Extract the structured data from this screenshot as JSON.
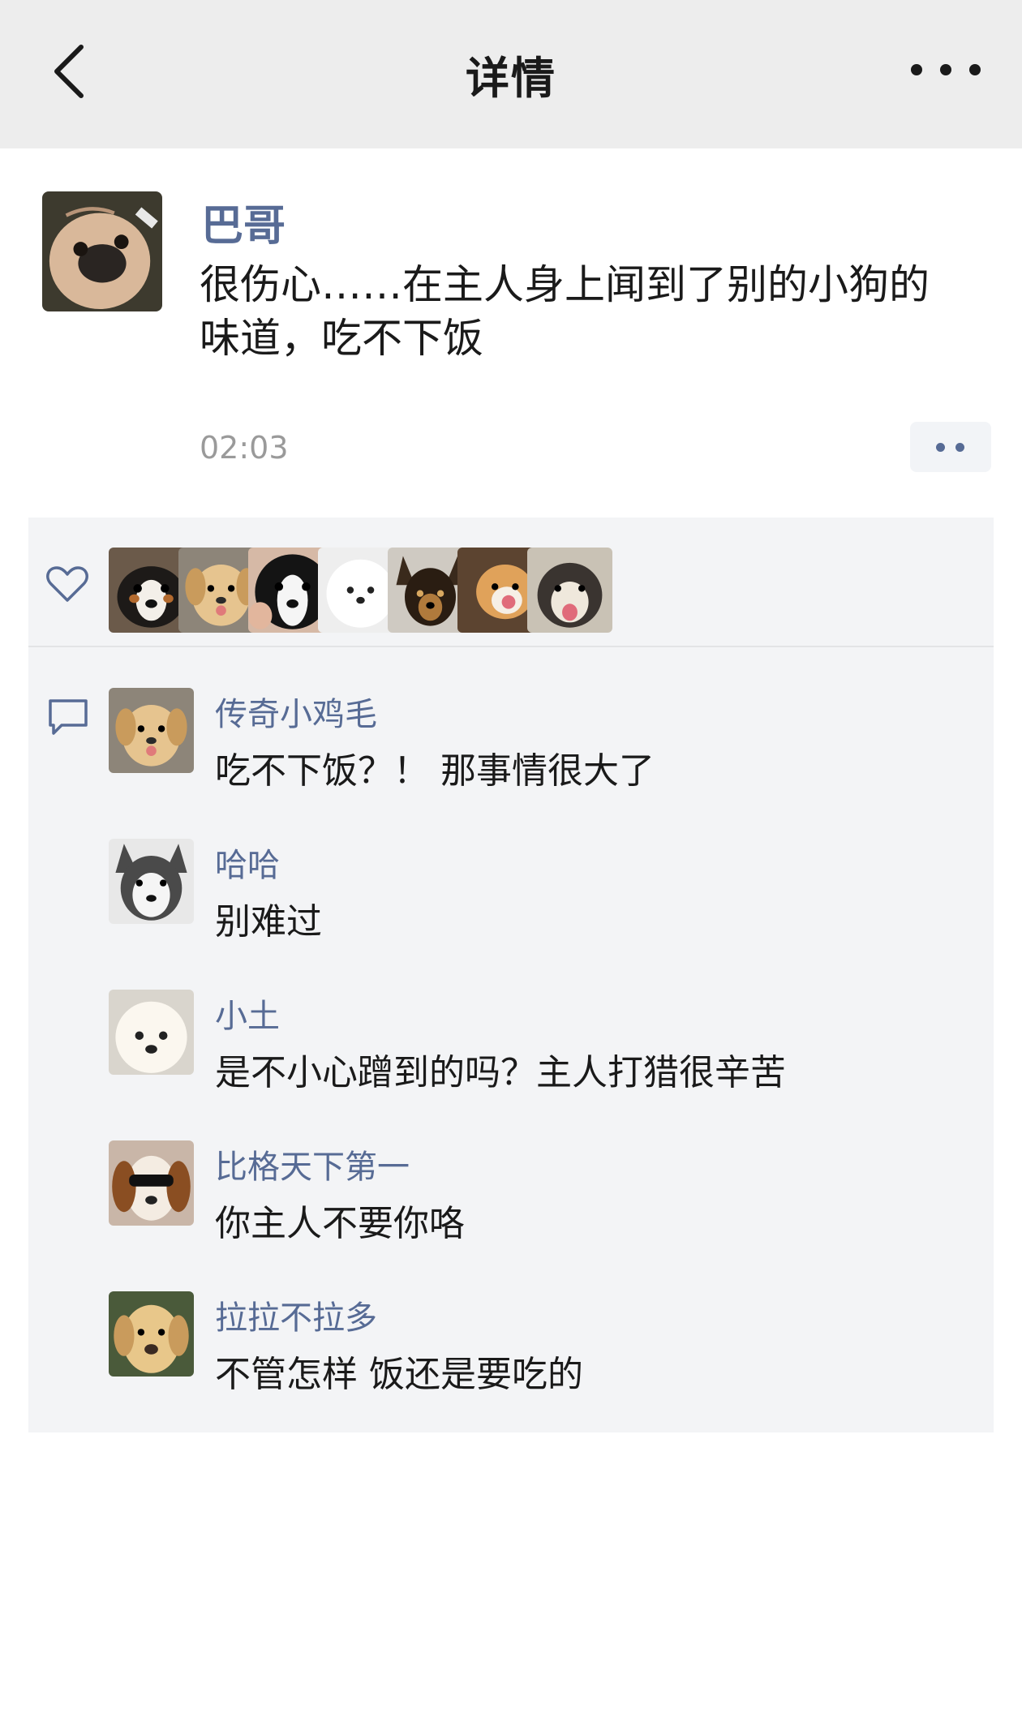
{
  "header": {
    "title": "详情",
    "back_icon": "chevron-left-icon",
    "more_icon": "more-dots-icon"
  },
  "post": {
    "author": "巴哥",
    "text": "很伤心……在主人身上闻到了别的小狗的味道，吃不下饭",
    "time": "02:03",
    "action_icon": "comment-like-menu-icon"
  },
  "likes": {
    "icon": "heart-outline-icon",
    "users": [
      "bernese-puppy",
      "golden-puppy",
      "black-white-puppy",
      "samoyed-puppy",
      "german-shepherd-puppy",
      "corgi-puppy",
      "husky-puppy"
    ]
  },
  "comments": {
    "icon": "comment-bubble-icon",
    "items": [
      {
        "name": "传奇小鸡毛",
        "text": "吃不下饭？！ 那事情很大了"
      },
      {
        "name": "哈哈",
        "text": "别难过"
      },
      {
        "name": "小土",
        "text": "是不小心蹭到的吗？主人打猎很辛苦"
      },
      {
        "name": "比格天下第一",
        "text": "你主人不要你咯"
      },
      {
        "name": "拉拉不拉多",
        "text": "不管怎样 饭还是要吃的"
      }
    ]
  },
  "colors": {
    "link": "#576b95",
    "header_bg": "#ededed",
    "panel_bg": "#f3f4f6"
  }
}
